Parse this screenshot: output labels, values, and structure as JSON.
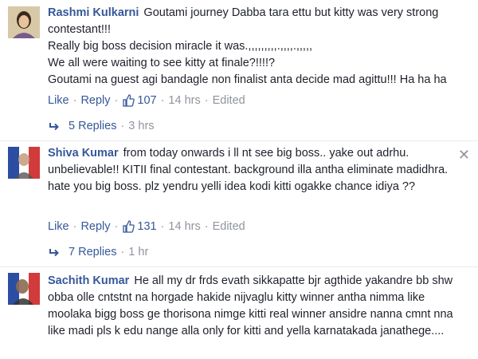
{
  "comments": [
    {
      "author": "Rashmi Kulkarni",
      "text": "Goutami journey Dabba tara ettu but kitty was very strong contestant!!!\nReally big boss decision miracle it was.,,,,,,,,,.,,,,.,,,,,\nWe all were waiting to see kitty at finale?!!!!?\nGoutami na guest agi bandagle non finalist anta decide mad agittu!!! Ha ha ha",
      "like_label": "Like",
      "reply_label": "Reply",
      "likes": "107",
      "time": "14 hrs",
      "edited": "Edited",
      "replies_label": "5 Replies",
      "replies_time": "3 hrs"
    },
    {
      "author": "Shiva Kumar",
      "text": "from today onwards i ll nt see big boss.. yake out adrhu. unbelievable!! KITII final contestant. background illa antha eliminate madidhra. hate you big boss. plz yendru yelli idea kodi kitti ogakke chance idiya ??",
      "like_label": "Like",
      "reply_label": "Reply",
      "likes": "131",
      "time": "14 hrs",
      "edited": "Edited",
      "replies_label": "7 Replies",
      "replies_time": "1 hr"
    },
    {
      "author": "Sachith Kumar",
      "text": "He all my dr frds evath sikkapatte bjr agthide yakandre bb shw obba olle cntstnt na horgade hakide nijvaglu kitty winner antha nimma like moolaka bigg boss ge thorisona nimge kitti real winner ansidre nanna cmnt nna like madi pls k edu nange alla only for kitti and yella karnatakada janathege...."
    }
  ],
  "icons": {
    "close": "close-icon",
    "thumb": "thumbs-up-icon",
    "reply_arrow": "reply-arrow-icon"
  },
  "colors": {
    "link": "#365899",
    "meta": "#90949c",
    "text": "#1d2129"
  }
}
